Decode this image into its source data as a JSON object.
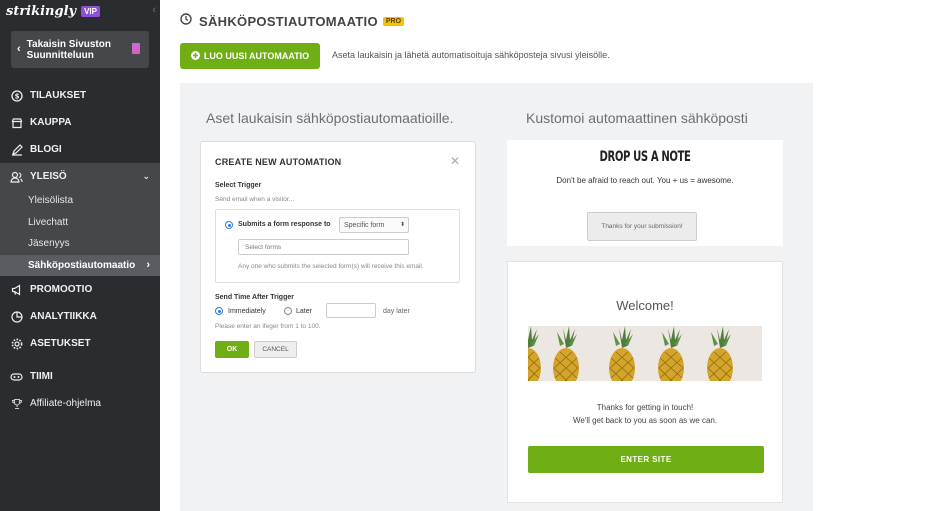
{
  "sidebar": {
    "logo": "strikingly",
    "vip": "VIP",
    "back_label_1": "Takaisin Sivuston",
    "back_label_2": "Suunnitteluun",
    "items": {
      "orders": "TILAUKSET",
      "store": "KAUPPA",
      "blog": "BLOGI",
      "audience": "YLEISÖ",
      "promo": "PROMOOTIO",
      "analytics": "ANALYTIIKKA",
      "settings": "ASETUKSET",
      "team": "TIIMI",
      "affiliate": "Affiliate-ohjelma"
    },
    "subitems": {
      "audience_list": "Yleisölista",
      "livechat": "Livechatt",
      "membership": "Jäsenyys",
      "email_automation": "Sähköpostiautomaatio"
    }
  },
  "header": {
    "title": "SÄHKÖPOSTIAUTOMAATIO",
    "badge": "PRO",
    "create_button": "LUO UUSI AUTOMAATIO",
    "description": "Aseta laukaisin ja lähetä automatisoituja sähköposteja sivusi yleisölle."
  },
  "panel": {
    "left_title": "Aset laukaisin sähköpostiautomaatioille.",
    "right_title": "Kustomoi automaattinen sähköposti",
    "modal": {
      "title": "CREATE NEW AUTOMATION",
      "select_trigger": "Select Trigger",
      "send_email_hint": "Send email when a visitor...",
      "submits_label": "Submits a form response to",
      "form_select": "Specific form",
      "forms_placeholder": "Select forms",
      "forms_note": "Any one who submits the selected form(s) will receive this email.",
      "send_time_label": "Send Time After Trigger",
      "immediately": "Immediately",
      "later": "Later",
      "day_later": "day later",
      "range_hint": "Please enter an ifeger from 1 to 100.",
      "ok": "OK",
      "cancel": "CANCEL"
    },
    "preview1": {
      "title": "DROP US A NOTE",
      "subtitle": "Don't be afraid to reach out. You + us = awesome.",
      "button": "Thanks for your submission!"
    },
    "preview2": {
      "welcome": "Welcome!",
      "line1": "Thanks for getting in touch!",
      "line2": "We'll get back to you as soon as we can.",
      "button": "ENTER SITE"
    }
  },
  "colors": {
    "accent": "#6fae15",
    "sidebar_bg": "#2b2c2f",
    "vip": "#8e51d6",
    "pro": "#f4c20d"
  }
}
